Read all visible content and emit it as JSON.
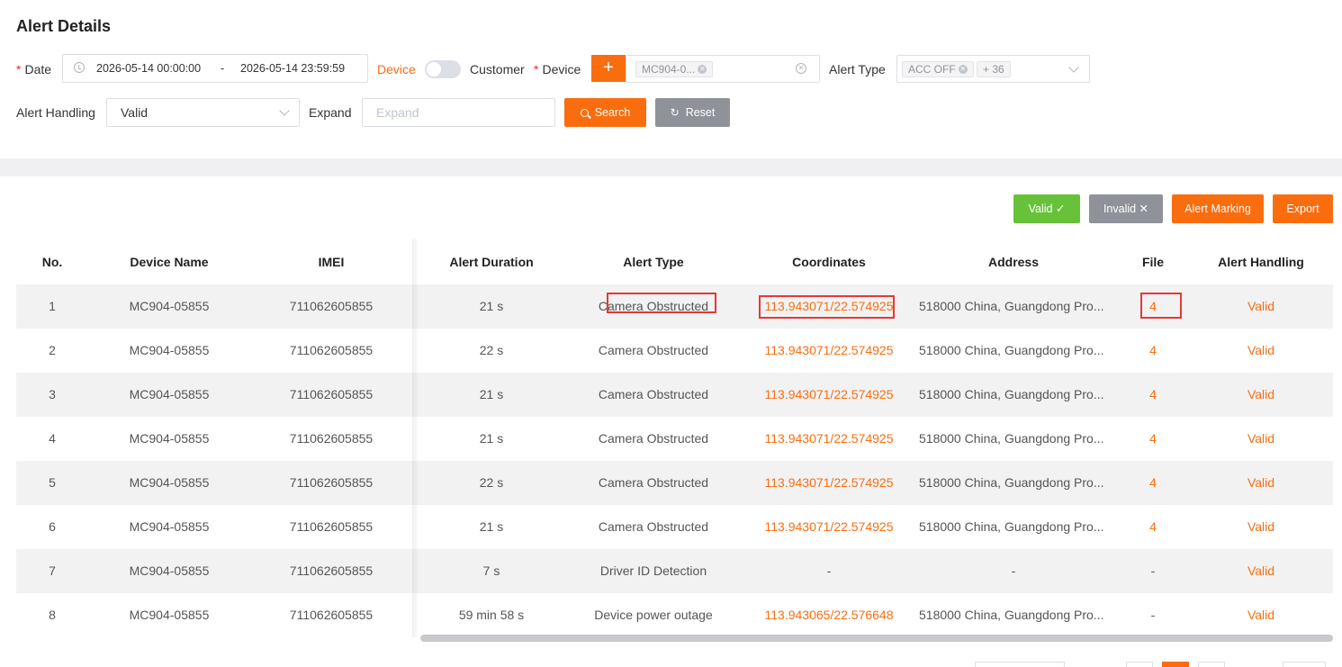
{
  "page": {
    "title": "Alert Details"
  },
  "filters": {
    "date_label": "Date",
    "date_start": "2026-05-14 00:00:00",
    "date_sep": "-",
    "date_end": "2026-05-14 23:59:59",
    "toggle_left": "Device",
    "toggle_right": "Customer",
    "device_label": "Device",
    "device_add": "+",
    "device_tag": "MC904-0...",
    "alert_type_label": "Alert Type",
    "alert_type_tag": "ACC OFF",
    "alert_type_more": "+ 36",
    "alert_handling_label": "Alert Handling",
    "alert_handling_value": "Valid",
    "expand_label": "Expand",
    "expand_placeholder": "Expand",
    "search_label": "Search",
    "reset_label": "Reset"
  },
  "actions": {
    "valid": "Valid ✓",
    "invalid": "Invalid ✕",
    "alert_marking": "Alert Marking",
    "export": "Export"
  },
  "table": {
    "columns": [
      "No.",
      "Device Name",
      "IMEI",
      "Alert Duration",
      "Alert Type",
      "Coordinates",
      "Address",
      "File",
      "Alert Handling"
    ],
    "rows": [
      {
        "no": "1",
        "device": "MC904-05855",
        "imei": "711062605855",
        "duration": "21 s",
        "type": "Camera Obstructed",
        "coords": "113.943071/22.574925",
        "address": "518000 China, Guangdong Pro...",
        "file": "4",
        "handling": "Valid"
      },
      {
        "no": "2",
        "device": "MC904-05855",
        "imei": "711062605855",
        "duration": "22 s",
        "type": "Camera Obstructed",
        "coords": "113.943071/22.574925",
        "address": "518000 China, Guangdong Pro...",
        "file": "4",
        "handling": "Valid"
      },
      {
        "no": "3",
        "device": "MC904-05855",
        "imei": "711062605855",
        "duration": "21 s",
        "type": "Camera Obstructed",
        "coords": "113.943071/22.574925",
        "address": "518000 China, Guangdong Pro...",
        "file": "4",
        "handling": "Valid"
      },
      {
        "no": "4",
        "device": "MC904-05855",
        "imei": "711062605855",
        "duration": "21 s",
        "type": "Camera Obstructed",
        "coords": "113.943071/22.574925",
        "address": "518000 China, Guangdong Pro...",
        "file": "4",
        "handling": "Valid"
      },
      {
        "no": "5",
        "device": "MC904-05855",
        "imei": "711062605855",
        "duration": "22 s",
        "type": "Camera Obstructed",
        "coords": "113.943071/22.574925",
        "address": "518000 China, Guangdong Pro...",
        "file": "4",
        "handling": "Valid"
      },
      {
        "no": "6",
        "device": "MC904-05855",
        "imei": "711062605855",
        "duration": "21 s",
        "type": "Camera Obstructed",
        "coords": "113.943071/22.574925",
        "address": "518000 China, Guangdong Pro...",
        "file": "4",
        "handling": "Valid"
      },
      {
        "no": "7",
        "device": "MC904-05855",
        "imei": "711062605855",
        "duration": "7 s",
        "type": "Driver ID Detection",
        "coords": "-",
        "address": "-",
        "file": "-",
        "handling": "Valid"
      },
      {
        "no": "8",
        "device": "MC904-05855",
        "imei": "711062605855",
        "duration": "59 min 58 s",
        "type": "Device power outage",
        "coords": "113.943065/22.576648",
        "address": "518000 China, Guangdong Pro...",
        "file": "-",
        "handling": "Valid"
      }
    ]
  },
  "colors": {
    "accent": "#fa6d0e",
    "valid_green": "#67c23a",
    "grey_button": "#8f9298",
    "highlight_red": "#e53935"
  }
}
